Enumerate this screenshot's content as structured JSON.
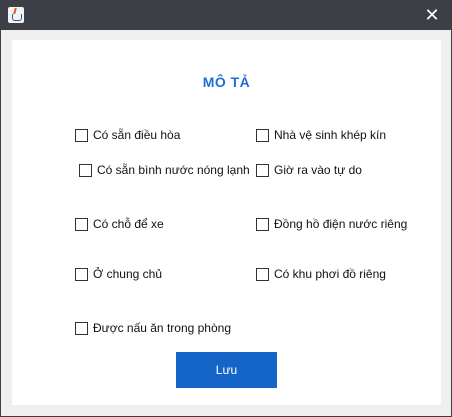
{
  "window": {
    "close_glyph": "✕"
  },
  "panel": {
    "title": "MÔ TẢ"
  },
  "amenities": {
    "air_conditioner": "Có sẵn điều hòa",
    "private_bathroom": "Nhà vệ sinh khép kín",
    "water_heater": "Có sẵn bình nước nóng lạnh",
    "free_hours": "Giờ ra vào tự do",
    "parking": "Có chỗ để xe",
    "separate_meter": "Đồng hồ điện nước riêng",
    "with_owner": "Ở chung chủ",
    "private_drying": "Có khu phơi đồ riêng",
    "cooking": "Được nấu ăn trong phòng"
  },
  "save_label": "Lưu",
  "colors": {
    "accent": "#1565c8",
    "title": "#1d6fd6"
  }
}
